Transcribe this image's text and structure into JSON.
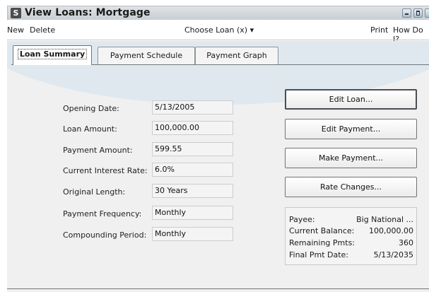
{
  "window": {
    "app_icon_letter": "S",
    "title": "View Loans: Mortgage"
  },
  "menu": {
    "new": "New",
    "delete": "Delete",
    "choose_loan": "Choose Loan (x) ▾",
    "print": "Print",
    "how_do_i": "How Do I?"
  },
  "tabs": [
    {
      "label": "Loan Summary",
      "active": true
    },
    {
      "label": "Payment Schedule",
      "active": false
    },
    {
      "label": "Payment Graph",
      "active": false
    }
  ],
  "fields": [
    {
      "label": "Opening Date:",
      "value": "5/13/2005"
    },
    {
      "label": "Loan Amount:",
      "value": "100,000.00"
    },
    {
      "label": "Payment Amount:",
      "value": "599.55"
    },
    {
      "label": "Current Interest Rate:",
      "value": "6.0%"
    },
    {
      "label": "Original Length:",
      "value": "30 Years"
    },
    {
      "label": "Payment Frequency:",
      "value": "Monthly"
    },
    {
      "label": "Compounding Period:",
      "value": "Monthly"
    }
  ],
  "buttons": {
    "edit_loan": "Edit Loan...",
    "edit_payment": "Edit Payment...",
    "make_payment": "Make Payment...",
    "rate_changes": "Rate Changes..."
  },
  "summary": {
    "payee_label": "Payee:",
    "payee_value": "Big National ...",
    "balance_label": "Current Balance:",
    "balance_value": "100,000.00",
    "remaining_label": "Remaining Pmts:",
    "remaining_value": "360",
    "final_label": "Final Pmt Date:",
    "final_value": "5/13/2035"
  },
  "colors": {
    "accent_swoosh": "#dfe8ee",
    "panel_bg": "#f0f0f0",
    "titlebar": "#c9ced3"
  }
}
